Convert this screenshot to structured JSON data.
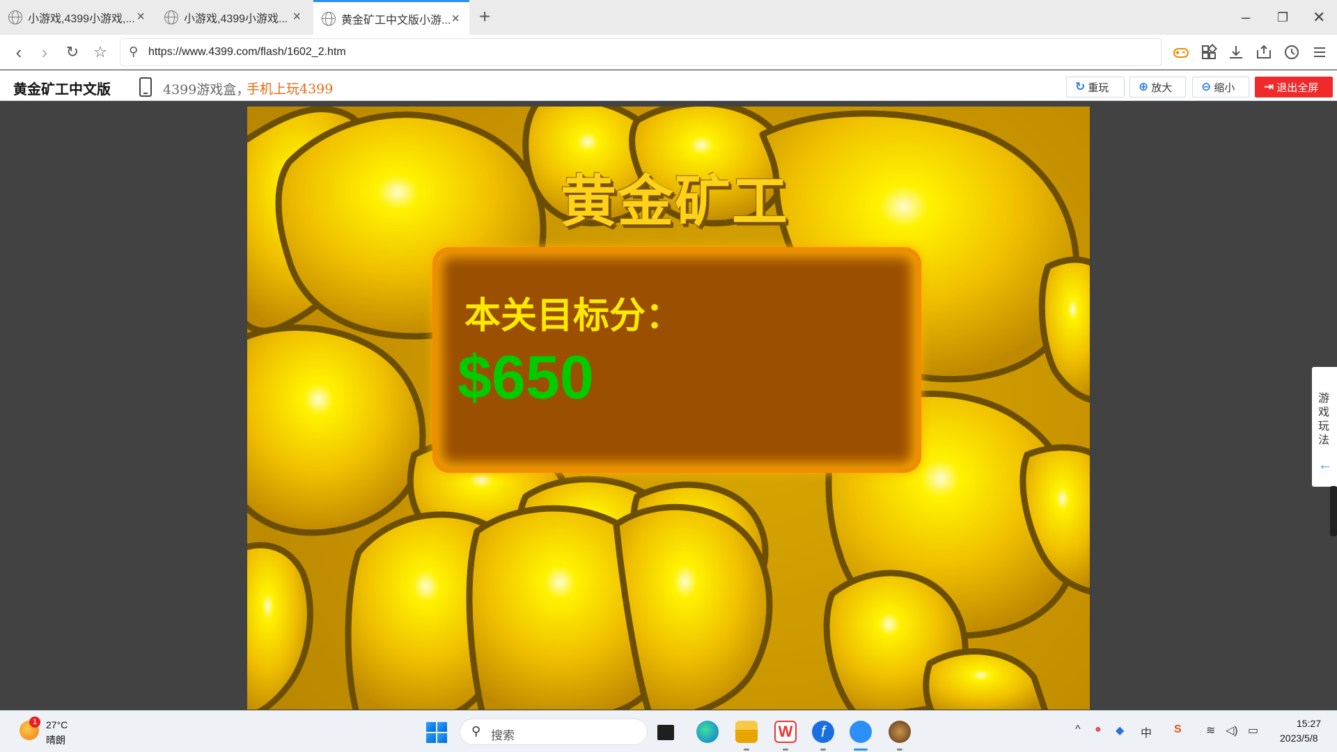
{
  "browser": {
    "tabs": [
      {
        "title": "小游戏,4399小游戏,..."
      },
      {
        "title": "小游戏,4399小游戏..."
      },
      {
        "title": "黄金矿工中文版小游..."
      }
    ],
    "new_tab": "+",
    "url": "https://www.4399.com/flash/1602_2.htm"
  },
  "sitebar": {
    "title": "黄金矿工中文版",
    "promo_prefix": "4399游戏盒，",
    "promo_highlight": "手机上玩4399",
    "buttons": {
      "replay": "重玩",
      "zoom_in": "放大",
      "zoom_out": "缩小",
      "exit_fullscreen": "退出全屏"
    }
  },
  "game": {
    "title": "黄金矿工",
    "target_label": "本关目标分：",
    "target_value": "$650"
  },
  "side_guide": {
    "label": "游戏玩法"
  },
  "taskbar": {
    "weather": {
      "temp": "27°C",
      "condition": "晴朗",
      "badge": "1"
    },
    "search_placeholder": "搜索",
    "tray_ime": "中",
    "time": "15:27",
    "date": "2023/5/8"
  },
  "colors": {
    "accent": "#2a8ff7",
    "exit_button": "#f02a2a",
    "target_value": "#00cc00",
    "panel": "#9b4f00"
  }
}
